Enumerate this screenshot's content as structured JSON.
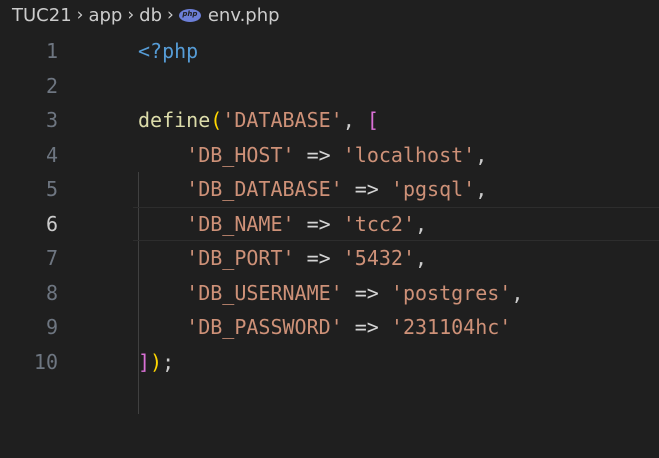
{
  "breadcrumb": {
    "segments": [
      "TUC21",
      "app",
      "db",
      "env.php"
    ],
    "separator": "›",
    "file_icon": "php-file-icon"
  },
  "editor": {
    "current_line": 6,
    "lines": [
      {
        "number": "1",
        "text": "<?php"
      },
      {
        "number": "2",
        "text": ""
      },
      {
        "number": "3",
        "text": "define('DATABASE', ["
      },
      {
        "number": "4",
        "text": "    'DB_HOST' => 'localhost',"
      },
      {
        "number": "5",
        "text": "    'DB_DATABASE' => 'pgsql',"
      },
      {
        "number": "6",
        "text": "    'DB_NAME' => 'tcc2',"
      },
      {
        "number": "7",
        "text": "    'DB_PORT' => '5432',"
      },
      {
        "number": "8",
        "text": "    'DB_USERNAME' => 'postgres',"
      },
      {
        "number": "9",
        "text": "    'DB_PASSWORD' => '231104hc'"
      },
      {
        "number": "10",
        "text": "]);"
      }
    ],
    "tokens": {
      "php_open": "<?php",
      "define": "define",
      "open_paren": "(",
      "database_key": "'DATABASE'",
      "comma": ",",
      "open_bracket": "[",
      "arrow": "=>",
      "entries": [
        {
          "key": "'DB_HOST'",
          "value": "'localhost'",
          "trail": ","
        },
        {
          "key": "'DB_DATABASE'",
          "value": "'pgsql'",
          "trail": ","
        },
        {
          "key": "'DB_NAME'",
          "value": "'tcc2'",
          "trail": ","
        },
        {
          "key": "'DB_PORT'",
          "value": "'5432'",
          "trail": ","
        },
        {
          "key": "'DB_USERNAME'",
          "value": "'postgres'",
          "trail": ","
        },
        {
          "key": "'DB_PASSWORD'",
          "value": "'231104hc'",
          "trail": ""
        }
      ],
      "close_bracket": "]",
      "close_paren": ")",
      "semicolon": ";"
    }
  },
  "colors": {
    "background": "#1f1f1f",
    "keyword": "#569cd6",
    "function": "#dcdcaa",
    "string": "#ce9178",
    "bracket_level1": "#ffd700",
    "bracket_level2": "#da70d6"
  }
}
